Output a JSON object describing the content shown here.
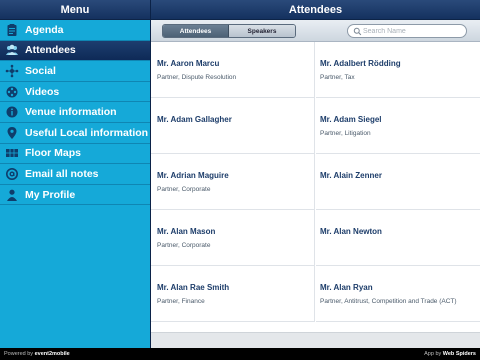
{
  "sidebar": {
    "title": "Menu",
    "items": [
      {
        "label": "Agenda",
        "icon": "clipboard-icon"
      },
      {
        "label": "Attendees",
        "icon": "people-icon"
      },
      {
        "label": "Social",
        "icon": "network-icon"
      },
      {
        "label": "Videos",
        "icon": "film-reel-icon"
      },
      {
        "label": "Venue information",
        "icon": "info-icon"
      },
      {
        "label": "Useful Local information",
        "icon": "location-pin-icon"
      },
      {
        "label": "Floor Maps",
        "icon": "floor-map-icon"
      },
      {
        "label": "Email all notes",
        "icon": "email-at-icon"
      },
      {
        "label": "My Profile",
        "icon": "person-icon"
      }
    ],
    "active_index": 1
  },
  "main": {
    "title": "Attendees",
    "segments": [
      "Attendees",
      "Speakers"
    ],
    "active_segment": "Attendees",
    "search_placeholder": "Search Name",
    "attendees": [
      {
        "name": "Mr. Aaron Marcu",
        "role": "Partner, Dispute Resolution"
      },
      {
        "name": "Mr. Adalbert Rödding",
        "role": "Partner, Tax"
      },
      {
        "name": "Mr. Adam Gallagher",
        "role": ""
      },
      {
        "name": "Mr. Adam Siegel",
        "role": "Partner, Litigation"
      },
      {
        "name": "Mr. Adrian Maguire",
        "role": "Partner, Corporate"
      },
      {
        "name": "Mr. Alain Zenner",
        "role": ""
      },
      {
        "name": "Mr. Alan Mason",
        "role": "Partner, Corporate"
      },
      {
        "name": "Mr. Alan Newton",
        "role": ""
      },
      {
        "name": "Mr. Alan Rae Smith",
        "role": "Partner, Finance"
      },
      {
        "name": "Mr. Alan Ryan",
        "role": "Partner, Antitrust, Competition and Trade (ACT)"
      }
    ]
  },
  "footer": {
    "powered_prefix": "Powered by",
    "powered_brand": "event2mobile",
    "app_prefix": "App by",
    "app_brand": "Web Spiders"
  },
  "colors": {
    "sidebar_bg": "#15a9d8",
    "header_bg": "#14315f",
    "name_text": "#1d3d6a"
  }
}
